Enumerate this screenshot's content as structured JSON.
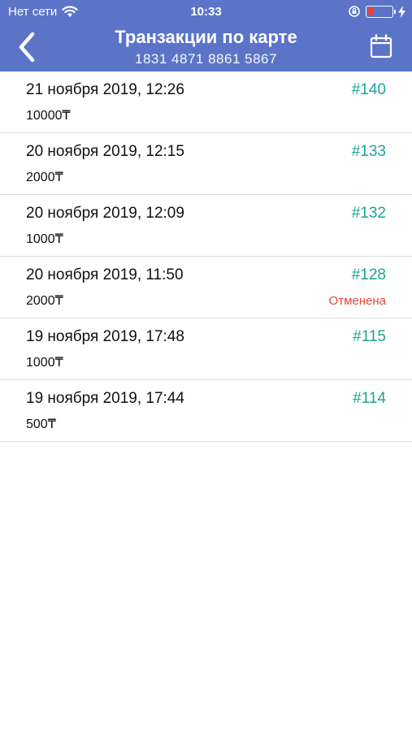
{
  "status_bar": {
    "carrier": "Нет сети",
    "time": "10:33"
  },
  "header": {
    "title": "Транзакции по карте",
    "card_number": "1831 4871 8861 5867",
    "back_icon": "chevron-left-icon",
    "calendar_icon": "calendar-icon"
  },
  "colors": {
    "header_bg": "#5b74c8",
    "accent": "#1aa597",
    "cancelled": "#e0463a"
  },
  "transactions": [
    {
      "date": "21 ноября 2019, 12:26",
      "amount": "10000₸",
      "number": "#140",
      "status": ""
    },
    {
      "date": "20 ноября 2019, 12:15",
      "amount": "2000₸",
      "number": "#133",
      "status": ""
    },
    {
      "date": "20 ноября 2019, 12:09",
      "amount": "1000₸",
      "number": "#132",
      "status": ""
    },
    {
      "date": "20 ноября 2019, 11:50",
      "amount": "2000₸",
      "number": "#128",
      "status": "Отменена"
    },
    {
      "date": "19 ноября 2019, 17:48",
      "amount": "1000₸",
      "number": "#115",
      "status": ""
    },
    {
      "date": "19 ноября 2019, 17:44",
      "amount": "500₸",
      "number": "#114",
      "status": ""
    }
  ]
}
